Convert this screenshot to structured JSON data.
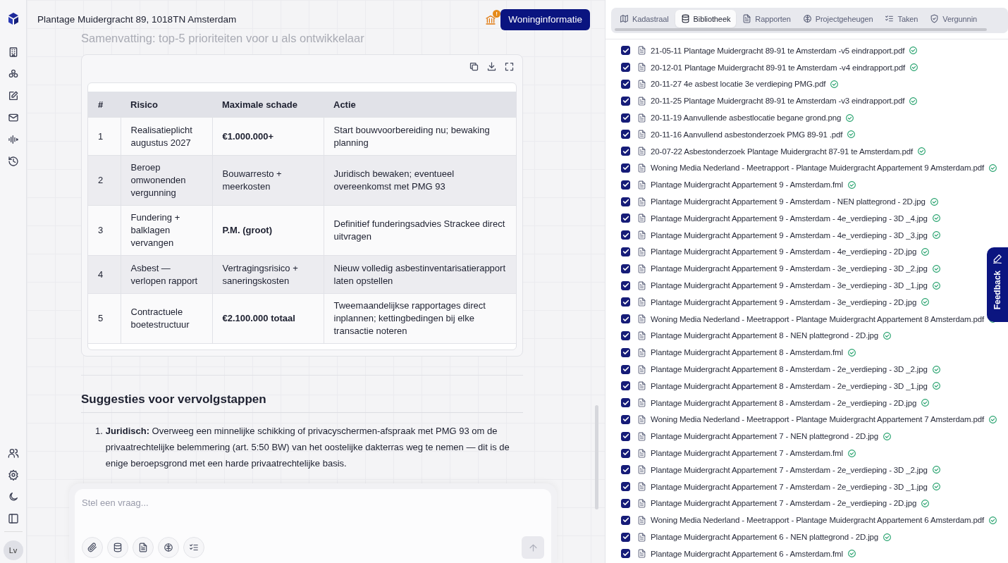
{
  "rail": {
    "avatar": "Lv"
  },
  "header": {
    "address": "Plantage Muidergracht 89, 1018TN Amsterdam",
    "alert_badge": "!",
    "button": "Woninginformatie"
  },
  "summary": {
    "heading": "Samenvatting: top-5 prioriteiten voor u als ontwikkelaar",
    "table": {
      "columns": [
        "#",
        "Risico",
        "Maximale schade",
        "Actie"
      ],
      "rows": [
        {
          "nr": "1",
          "risico": "Realisatieplicht augustus 2027",
          "schade": "€1.000.000+",
          "schade_bold": true,
          "actie": "Start bouwvoorbereiding nu; bewaking planning"
        },
        {
          "nr": "2",
          "risico": "Beroep omwonenden vergunning",
          "schade": "Bouwarresto + meerkosten",
          "schade_bold": false,
          "actie": "Juridisch bewaken; eventueel overeenkomst met PMG 93"
        },
        {
          "nr": "3",
          "risico": "Fundering + balklagen vervangen",
          "schade": "P.M. (groot)",
          "schade_bold": true,
          "actie": "Definitief funderingsadvies Strackee direct uitvragen"
        },
        {
          "nr": "4",
          "risico": "Asbest — verlopen rapport",
          "schade": "Vertragingsrisico + saneringskosten",
          "schade_bold": false,
          "actie": "Nieuw volledig asbestinventarisatierapport laten opstellen"
        },
        {
          "nr": "5",
          "risico": "Contractuele boetestructuur",
          "schade": "€2.100.000 totaal",
          "schade_bold": true,
          "actie": "Tweemaandelijkse rapportages direct inplannen; kettingbedingen bij elke transactie noteren"
        }
      ]
    }
  },
  "suggestions": {
    "heading": "Suggesties voor vervolgstappen",
    "items": [
      {
        "number": "1.",
        "text": "**Juridisch:** Overweeg een minnelijke schikking of privacyschermen-afspraak met PMG 93 om de privaatrechtelijke belemmering (art. 5:50 BW) van het oostelijke dakterras weg te nemen — dit is de enige beroepsgrond met een harde privaatrechtelijke basis."
      }
    ]
  },
  "composer": {
    "placeholder": "Stel een vraag..."
  },
  "library": {
    "tabs": [
      {
        "label": "Kadastraal",
        "selected": false
      },
      {
        "label": "Bibliotheek",
        "selected": true
      },
      {
        "label": "Rapporten",
        "selected": false
      },
      {
        "label": "Projectgeheugen",
        "selected": false
      },
      {
        "label": "Taken",
        "selected": false
      },
      {
        "label": "Vergunnin",
        "selected": false
      }
    ],
    "files": [
      {
        "name": "21-05-11 Plantage Muidergracht 89-91 te Amsterdam -v5 eindrapport.pdf",
        "checked": true,
        "verified": true
      },
      {
        "name": "20-12-01 Plantage Muidergracht 89-91 te Amsterdam -v4 eindrapport.pdf",
        "checked": true,
        "verified": true
      },
      {
        "name": "20-11-27 4e asbest locatie 3e verdieping PMG.pdf",
        "checked": true,
        "verified": true
      },
      {
        "name": "20-11-25 Plantage Muidergracht 89-91 te Amsterdam -v3 eindrapport.pdf",
        "checked": true,
        "verified": true
      },
      {
        "name": "20-11-19 Aanvullende asbestlocatie begane grond.png",
        "checked": true,
        "verified": true
      },
      {
        "name": "20-11-16 Aanvullend asbestonderzoek PMG 89-91 .pdf",
        "checked": true,
        "verified": true
      },
      {
        "name": "20-07-22 Asbestonderzoek Plantage Muidergracht 87-91 te Amsterdam.pdf",
        "checked": true,
        "verified": true
      },
      {
        "name": "Woning Media Nederland - Meetrapport - Plantage Muidergracht Appartement 9 Amsterdam.pdf",
        "checked": true,
        "verified": true
      },
      {
        "name": "Plantage Muidergracht Appartement 9 - Amsterdam.fml",
        "checked": true,
        "verified": true
      },
      {
        "name": "Plantage Muidergracht Appartement 9 - Amsterdam - NEN plattegrond - 2D.jpg",
        "checked": true,
        "verified": true
      },
      {
        "name": "Plantage Muidergracht Appartement 9 - Amsterdam - 4e_verdieping - 3D _4.jpg",
        "checked": true,
        "verified": true
      },
      {
        "name": "Plantage Muidergracht Appartement 9 - Amsterdam - 4e_verdieping - 3D _3.jpg",
        "checked": true,
        "verified": true
      },
      {
        "name": "Plantage Muidergracht Appartement 9 - Amsterdam - 4e_verdieping - 2D.jpg",
        "checked": true,
        "verified": true
      },
      {
        "name": "Plantage Muidergracht Appartement 9 - Amsterdam - 3e_verdieping - 3D _2.jpg",
        "checked": true,
        "verified": true
      },
      {
        "name": "Plantage Muidergracht Appartement 9 - Amsterdam - 3e_verdieping - 3D _1.jpg",
        "checked": true,
        "verified": true
      },
      {
        "name": "Plantage Muidergracht Appartement 9 - Amsterdam - 3e_verdieping - 2D.jpg",
        "checked": true,
        "verified": true
      },
      {
        "name": "Woning Media Nederland - Meetrapport - Plantage Muidergracht Appartement 8 Amsterdam.pdf",
        "checked": true,
        "verified": true
      },
      {
        "name": "Plantage Muidergracht Appartement 8 - NEN plattegrond - 2D.jpg",
        "checked": true,
        "verified": true
      },
      {
        "name": "Plantage Muidergracht Appartement 8 - Amsterdam.fml",
        "checked": true,
        "verified": true
      },
      {
        "name": "Plantage Muidergracht Appartement 8 - Amsterdam - 2e_verdieping - 3D _2.jpg",
        "checked": true,
        "verified": true
      },
      {
        "name": "Plantage Muidergracht Appartement 8 - Amsterdam - 2e_verdieping - 3D _1.jpg",
        "checked": true,
        "verified": true
      },
      {
        "name": "Plantage Muidergracht Appartement 8 - Amsterdam - 2e_verdieping - 2D.jpg",
        "checked": true,
        "verified": true
      },
      {
        "name": "Woning Media Nederland - Meetrapport - Plantage Muidergracht Appartement 7 Amsterdam.pdf",
        "checked": true,
        "verified": true
      },
      {
        "name": "Plantage Muidergracht Appartement 7 - NEN plattegrond - 2D.jpg",
        "checked": true,
        "verified": true
      },
      {
        "name": "Plantage Muidergracht Appartement 7 - Amsterdam.fml",
        "checked": true,
        "verified": true
      },
      {
        "name": "Plantage Muidergracht Appartement 7 - Amsterdam - 2e_verdieping - 3D _2.jpg",
        "checked": true,
        "verified": true
      },
      {
        "name": "Plantage Muidergracht Appartement 7 - Amsterdam - 2e_verdieping - 3D _1.jpg",
        "checked": true,
        "verified": true
      },
      {
        "name": "Plantage Muidergracht Appartement 7 - Amsterdam - 2e_verdieping - 2D.jpg",
        "checked": true,
        "verified": true
      },
      {
        "name": "Woning Media Nederland - Meetrapport - Plantage Muidergracht Appartement 6 Amsterdam.pdf",
        "checked": true,
        "verified": true
      },
      {
        "name": "Plantage Muidergracht Appartement 6 - NEN plattegrond - 2D.jpg",
        "checked": true,
        "verified": true
      },
      {
        "name": "Plantage Muidergracht Appartement 6 - Amsterdam.fml",
        "checked": true,
        "verified": true
      }
    ]
  },
  "feedback": {
    "label": "Feedback"
  }
}
